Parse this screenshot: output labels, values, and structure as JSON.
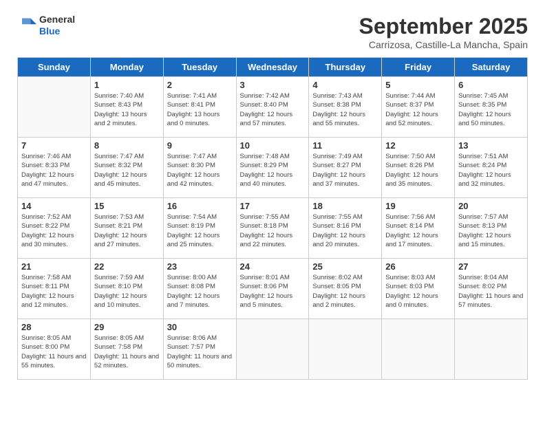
{
  "header": {
    "logo_line1": "General",
    "logo_line2": "Blue",
    "month_title": "September 2025",
    "location": "Carrizosa, Castille-La Mancha, Spain"
  },
  "days_of_week": [
    "Sunday",
    "Monday",
    "Tuesday",
    "Wednesday",
    "Thursday",
    "Friday",
    "Saturday"
  ],
  "weeks": [
    [
      {
        "day": "",
        "sunrise": "",
        "sunset": "",
        "daylight": ""
      },
      {
        "day": "1",
        "sunrise": "Sunrise: 7:40 AM",
        "sunset": "Sunset: 8:43 PM",
        "daylight": "Daylight: 13 hours and 2 minutes."
      },
      {
        "day": "2",
        "sunrise": "Sunrise: 7:41 AM",
        "sunset": "Sunset: 8:41 PM",
        "daylight": "Daylight: 13 hours and 0 minutes."
      },
      {
        "day": "3",
        "sunrise": "Sunrise: 7:42 AM",
        "sunset": "Sunset: 8:40 PM",
        "daylight": "Daylight: 12 hours and 57 minutes."
      },
      {
        "day": "4",
        "sunrise": "Sunrise: 7:43 AM",
        "sunset": "Sunset: 8:38 PM",
        "daylight": "Daylight: 12 hours and 55 minutes."
      },
      {
        "day": "5",
        "sunrise": "Sunrise: 7:44 AM",
        "sunset": "Sunset: 8:37 PM",
        "daylight": "Daylight: 12 hours and 52 minutes."
      },
      {
        "day": "6",
        "sunrise": "Sunrise: 7:45 AM",
        "sunset": "Sunset: 8:35 PM",
        "daylight": "Daylight: 12 hours and 50 minutes."
      }
    ],
    [
      {
        "day": "7",
        "sunrise": "Sunrise: 7:46 AM",
        "sunset": "Sunset: 8:33 PM",
        "daylight": "Daylight: 12 hours and 47 minutes."
      },
      {
        "day": "8",
        "sunrise": "Sunrise: 7:47 AM",
        "sunset": "Sunset: 8:32 PM",
        "daylight": "Daylight: 12 hours and 45 minutes."
      },
      {
        "day": "9",
        "sunrise": "Sunrise: 7:47 AM",
        "sunset": "Sunset: 8:30 PM",
        "daylight": "Daylight: 12 hours and 42 minutes."
      },
      {
        "day": "10",
        "sunrise": "Sunrise: 7:48 AM",
        "sunset": "Sunset: 8:29 PM",
        "daylight": "Daylight: 12 hours and 40 minutes."
      },
      {
        "day": "11",
        "sunrise": "Sunrise: 7:49 AM",
        "sunset": "Sunset: 8:27 PM",
        "daylight": "Daylight: 12 hours and 37 minutes."
      },
      {
        "day": "12",
        "sunrise": "Sunrise: 7:50 AM",
        "sunset": "Sunset: 8:26 PM",
        "daylight": "Daylight: 12 hours and 35 minutes."
      },
      {
        "day": "13",
        "sunrise": "Sunrise: 7:51 AM",
        "sunset": "Sunset: 8:24 PM",
        "daylight": "Daylight: 12 hours and 32 minutes."
      }
    ],
    [
      {
        "day": "14",
        "sunrise": "Sunrise: 7:52 AM",
        "sunset": "Sunset: 8:22 PM",
        "daylight": "Daylight: 12 hours and 30 minutes."
      },
      {
        "day": "15",
        "sunrise": "Sunrise: 7:53 AM",
        "sunset": "Sunset: 8:21 PM",
        "daylight": "Daylight: 12 hours and 27 minutes."
      },
      {
        "day": "16",
        "sunrise": "Sunrise: 7:54 AM",
        "sunset": "Sunset: 8:19 PM",
        "daylight": "Daylight: 12 hours and 25 minutes."
      },
      {
        "day": "17",
        "sunrise": "Sunrise: 7:55 AM",
        "sunset": "Sunset: 8:18 PM",
        "daylight": "Daylight: 12 hours and 22 minutes."
      },
      {
        "day": "18",
        "sunrise": "Sunrise: 7:55 AM",
        "sunset": "Sunset: 8:16 PM",
        "daylight": "Daylight: 12 hours and 20 minutes."
      },
      {
        "day": "19",
        "sunrise": "Sunrise: 7:56 AM",
        "sunset": "Sunset: 8:14 PM",
        "daylight": "Daylight: 12 hours and 17 minutes."
      },
      {
        "day": "20",
        "sunrise": "Sunrise: 7:57 AM",
        "sunset": "Sunset: 8:13 PM",
        "daylight": "Daylight: 12 hours and 15 minutes."
      }
    ],
    [
      {
        "day": "21",
        "sunrise": "Sunrise: 7:58 AM",
        "sunset": "Sunset: 8:11 PM",
        "daylight": "Daylight: 12 hours and 12 minutes."
      },
      {
        "day": "22",
        "sunrise": "Sunrise: 7:59 AM",
        "sunset": "Sunset: 8:10 PM",
        "daylight": "Daylight: 12 hours and 10 minutes."
      },
      {
        "day": "23",
        "sunrise": "Sunrise: 8:00 AM",
        "sunset": "Sunset: 8:08 PM",
        "daylight": "Daylight: 12 hours and 7 minutes."
      },
      {
        "day": "24",
        "sunrise": "Sunrise: 8:01 AM",
        "sunset": "Sunset: 8:06 PM",
        "daylight": "Daylight: 12 hours and 5 minutes."
      },
      {
        "day": "25",
        "sunrise": "Sunrise: 8:02 AM",
        "sunset": "Sunset: 8:05 PM",
        "daylight": "Daylight: 12 hours and 2 minutes."
      },
      {
        "day": "26",
        "sunrise": "Sunrise: 8:03 AM",
        "sunset": "Sunset: 8:03 PM",
        "daylight": "Daylight: 12 hours and 0 minutes."
      },
      {
        "day": "27",
        "sunrise": "Sunrise: 8:04 AM",
        "sunset": "Sunset: 8:02 PM",
        "daylight": "Daylight: 11 hours and 57 minutes."
      }
    ],
    [
      {
        "day": "28",
        "sunrise": "Sunrise: 8:05 AM",
        "sunset": "Sunset: 8:00 PM",
        "daylight": "Daylight: 11 hours and 55 minutes."
      },
      {
        "day": "29",
        "sunrise": "Sunrise: 8:05 AM",
        "sunset": "Sunset: 7:58 PM",
        "daylight": "Daylight: 11 hours and 52 minutes."
      },
      {
        "day": "30",
        "sunrise": "Sunrise: 8:06 AM",
        "sunset": "Sunset: 7:57 PM",
        "daylight": "Daylight: 11 hours and 50 minutes."
      },
      {
        "day": "",
        "sunrise": "",
        "sunset": "",
        "daylight": ""
      },
      {
        "day": "",
        "sunrise": "",
        "sunset": "",
        "daylight": ""
      },
      {
        "day": "",
        "sunrise": "",
        "sunset": "",
        "daylight": ""
      },
      {
        "day": "",
        "sunrise": "",
        "sunset": "",
        "daylight": ""
      }
    ]
  ]
}
